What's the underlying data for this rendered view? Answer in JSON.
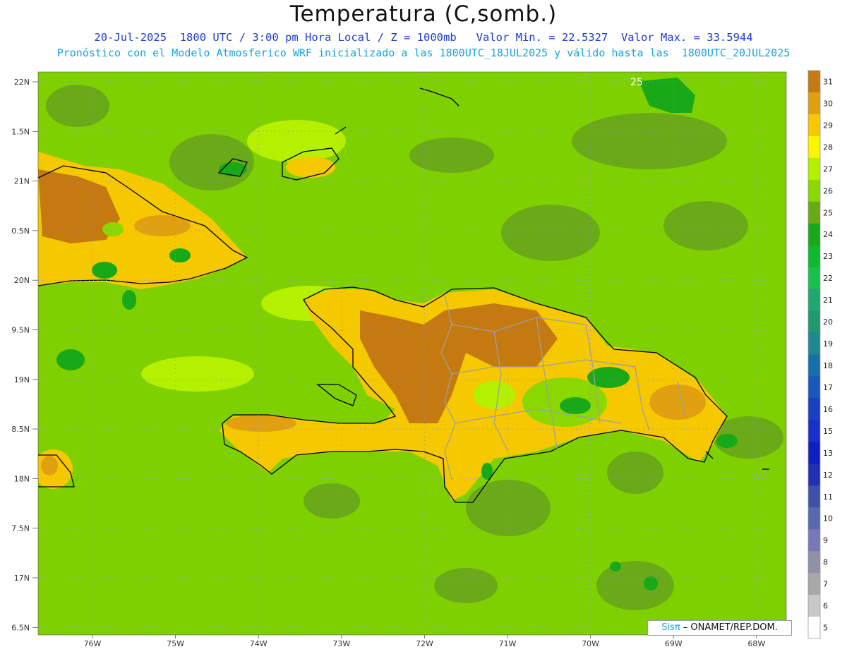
{
  "title": "Temperatura (C,somb.)",
  "subtitle_line1": "20-Jul-2025  1800 UTC / 3:00 pm Hora Local / Z = 1000mb   Valor Min. = 22.5327  Valor Max. = 33.5944",
  "subtitle_line2": "Pronóstico con el Modelo Atmosferico WRF inicializado a las 1800UTC_18JUL2025 y válido hasta las  1800UTC_20JUL2025",
  "credit": {
    "sis": "Sisπ",
    "rest": " – ONAMET/REP.DOM."
  },
  "contour_label": "25",
  "lat_labels": [
    "22N",
    "1.5N",
    "21N",
    "0.5N",
    "20N",
    "9.5N",
    "19N",
    "8.5N",
    "18N",
    "7.5N",
    "17N",
    "6.5N"
  ],
  "lon_labels": [
    "76W",
    "75W",
    "74W",
    "73W",
    "72W",
    "71W",
    "70W",
    "69W",
    "68W"
  ],
  "colorbar": {
    "labels": [
      "31",
      "30",
      "29",
      "28",
      "27",
      "26",
      "25",
      "24",
      "23",
      "22",
      "21",
      "20",
      "19",
      "18",
      "17",
      "16",
      "15",
      "13",
      "12",
      "11",
      "10",
      "9",
      "8",
      "7",
      "6",
      "5"
    ],
    "colors": [
      "#c47a10",
      "#e0a010",
      "#f5c800",
      "#faf500",
      "#b5f000",
      "#8ad800",
      "#6aaa18",
      "#18a818",
      "#10b830",
      "#18c050",
      "#20a870",
      "#209870",
      "#208890",
      "#1870a8",
      "#1858b8",
      "#1840c0",
      "#1830c8",
      "#1020c0",
      "#2030b0",
      "#4050a8",
      "#5a68b0",
      "#7878b8",
      "#9090a8",
      "#a8a8a8",
      "#c8c8c8",
      "#ffffff"
    ]
  },
  "colors": {
    "sea": "#7fd000",
    "sea_dark": "#6aaa18",
    "warm_land": "#f5c800",
    "hot_land": "#c47a10",
    "cool_patch": "#18a818",
    "coastline": "#000000",
    "borders": "#a0a0a0"
  }
}
